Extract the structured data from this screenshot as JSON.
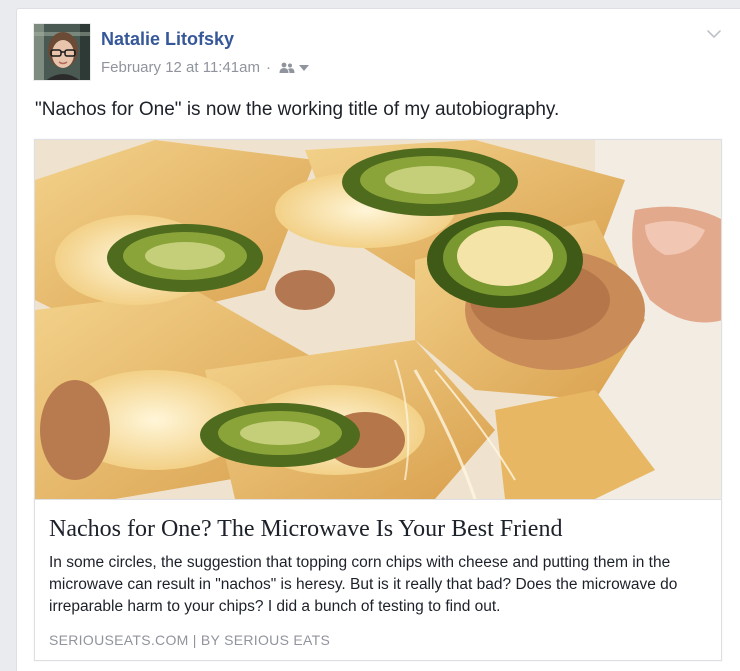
{
  "post": {
    "author_name": "Natalie Litofsky",
    "timestamp": "February 12 at 11:41am",
    "separator": "·",
    "audience_icon": "friends-icon",
    "audience_caret_icon": "caret-down-icon",
    "options_icon": "chevron-down-icon",
    "text": "\"Nachos for One\" is now the working title of my autobiography."
  },
  "link_preview": {
    "image_icon": "nachos-photo",
    "title": "Nachos for One? The Microwave Is Your Best Friend",
    "description": "In some circles, the suggestion that topping corn chips with cheese and putting them in the microwave can result in \"nachos\" is heresy. But is it really that bad? Does the microwave do irreparable harm to your chips? I did a bunch of testing to find out.",
    "source": "SERIOUSEATS.COM | BY SERIOUS EATS"
  },
  "colors": {
    "author_link": "#365899",
    "meta_text": "#90949c",
    "body_text": "#1d2129",
    "border": "#dddfe2",
    "page_bg": "#e9ebee"
  }
}
